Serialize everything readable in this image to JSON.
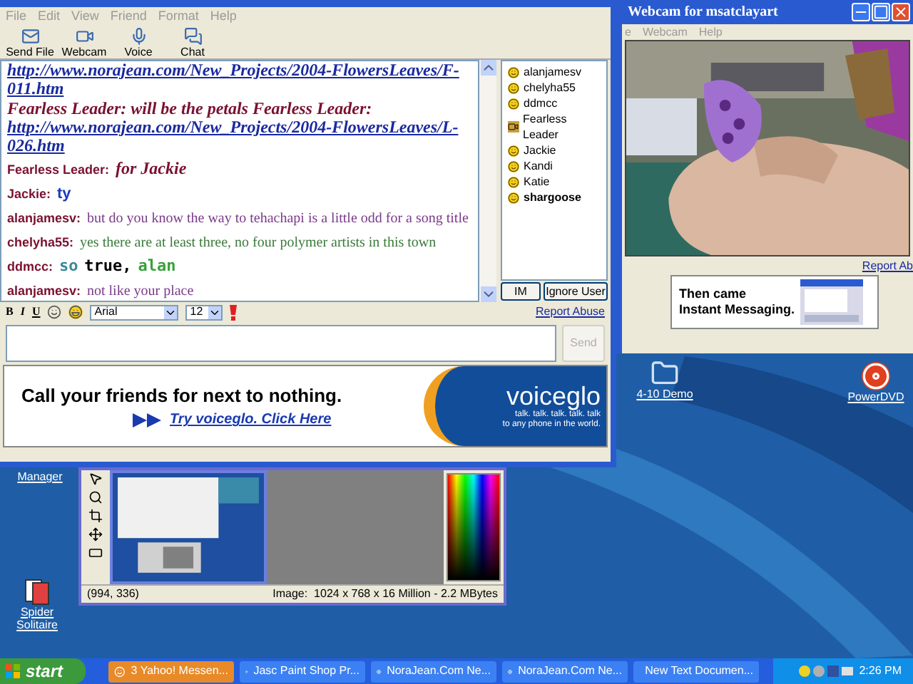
{
  "chat_window": {
    "menu": [
      "File",
      "Edit",
      "View",
      "Friend",
      "Format",
      "Help"
    ],
    "toolbar": [
      {
        "label": "Send File",
        "kind": "file"
      },
      {
        "label": "Webcam",
        "kind": "webcam"
      },
      {
        "label": "Voice",
        "kind": "voice"
      },
      {
        "label": "Chat",
        "kind": "chat"
      }
    ],
    "messages": [
      {
        "parts": [
          {
            "kind": "link",
            "text": "http://www.norajean.com/New_Projects/2004-FlowersLeaves/F-011.htm"
          },
          {
            "kind": "script",
            "text": "Fearless Leader: will be the petals Fearless Leader:",
            "color": "#7a1030"
          },
          {
            "kind": "link",
            "text": "http://www.norajean.com/New_Projects/2004-FlowersLeaves/L-026.htm"
          }
        ]
      },
      {
        "sender": "Fearless Leader:",
        "parts": [
          {
            "kind": "script",
            "text": "for Jackie",
            "color": "#7a1030"
          }
        ]
      },
      {
        "sender": "Jackie:",
        "parts": [
          {
            "kind": "bold",
            "text": "ty",
            "color": "#1a3ac0"
          }
        ]
      },
      {
        "sender": "alanjamesv:",
        "parts": [
          {
            "kind": "plain",
            "text": "but do you know the way to tehachapi is a little odd for a song title",
            "color": "#7a3a8a"
          }
        ]
      },
      {
        "sender": "chelyha55:",
        "parts": [
          {
            "kind": "plain",
            "text": "yes there are at least three, no four polymer artists in this town",
            "color": "#3a7a3a"
          }
        ]
      },
      {
        "sender": "ddmcc:",
        "parts": [
          {
            "kind": "mono",
            "text": "so",
            "color": "#3a8a9a"
          },
          {
            "kind": "mono",
            "text": "true,",
            "color": "#000000"
          },
          {
            "kind": "mono",
            "text": "alan",
            "color": "#3aa03a"
          }
        ]
      },
      {
        "sender": "alanjamesv:",
        "parts": [
          {
            "kind": "plain",
            "text": "not like your place",
            "color": "#7a3a8a"
          }
        ]
      }
    ],
    "users": [
      {
        "name": "alanjamesv",
        "kind": "smiley",
        "is_self": false
      },
      {
        "name": "chelyha55",
        "kind": "smiley",
        "is_self": false
      },
      {
        "name": "ddmcc",
        "kind": "smiley",
        "is_self": false
      },
      {
        "name": "Fearless Leader",
        "kind": "webcam",
        "is_self": false
      },
      {
        "name": "Jackie",
        "kind": "smiley",
        "is_self": false
      },
      {
        "name": "Kandi",
        "kind": "smiley",
        "is_self": false
      },
      {
        "name": "Katie",
        "kind": "smiley",
        "is_self": false
      },
      {
        "name": "shargoose",
        "kind": "smiley",
        "is_self": true
      }
    ],
    "user_buttons": [
      "IM",
      "Ignore User"
    ],
    "format_bar": {
      "bold": "B",
      "italic": "I",
      "underline": "U",
      "font": "Arial",
      "size": "12",
      "report_link": "Report Abuse"
    },
    "send_button": {
      "label": "Send",
      "disabled": true
    },
    "ad": {
      "headline": "Call your friends for next to nothing.",
      "link": "Try voiceglo. Click Here",
      "logo": "voiceglo",
      "tagline_1": "talk. talk. talk. talk. talk",
      "tagline_2": "to any phone in the world."
    }
  },
  "webcam_window": {
    "title": "Webcam for msatclayart",
    "menu": [
      "e",
      "Webcam",
      "Help"
    ],
    "report_link": "Report Ab",
    "ad_text_1": "Then came",
    "ad_text_2": "Instant Messaging."
  },
  "desktop_icons": [
    {
      "label": "4-10 Demo",
      "kind": "folder"
    },
    {
      "label": "PowerDVD",
      "kind": "disc"
    },
    {
      "label": "Manager",
      "kind": "none"
    },
    {
      "label": "Spider Solitaire",
      "kind": "cards"
    }
  ],
  "paint_window": {
    "coords": "(994, 336)",
    "image_info": "Image:  1024 x 768 x 16 Million - 2.2 MBytes"
  },
  "taskbar": {
    "start": "start",
    "tasks": [
      {
        "label": "3 Yahoo! Messen...",
        "attention": true
      },
      {
        "label": "Jasc Paint Shop Pr...",
        "attention": false
      },
      {
        "label": "NoraJean.Com Ne...",
        "attention": false
      },
      {
        "label": "NoraJean.Com Ne...",
        "attention": false
      },
      {
        "label": "New Text Documen...",
        "attention": false
      }
    ],
    "clock": "2:26 PM"
  }
}
